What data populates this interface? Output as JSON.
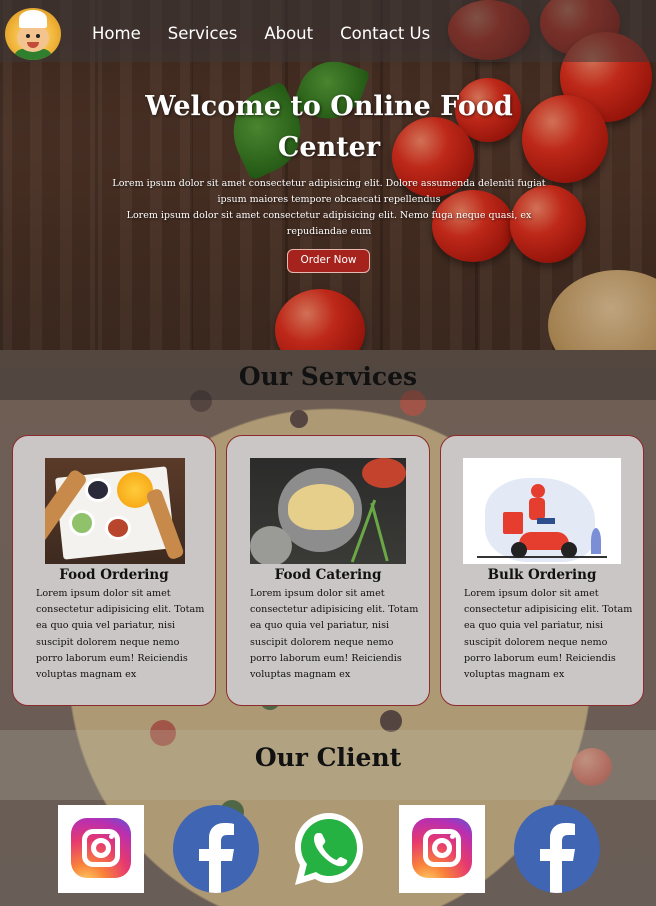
{
  "nav": {
    "links": [
      "Home",
      "Services",
      "About",
      "Contact Us"
    ]
  },
  "hero": {
    "title": "Welcome to Online Food Center",
    "paragraph1": "Lorem ipsum dolor sit amet consectetur adipisicing elit. Dolore assumenda deleniti fugiat ipsum maiores tempore obcaecati repellendus",
    "paragraph2": "Lorem ipsum dolor sit amet consectetur adipisicing elit. Nemo fuga neque quasi, ex repudiandae eum",
    "button": "Order Now",
    "accent_color": "#a6231d"
  },
  "services": {
    "title": "Our Services",
    "cards": [
      {
        "title": "Food Ordering",
        "text": "Lorem ipsum dolor sit amet consectetur adipisicing elit. Totam ea quo quia vel pariatur, nisi suscipit dolorem neque nemo porro laborum eum! Reiciendis voluptas magnam ex",
        "image": "food-platter-image"
      },
      {
        "title": "Food Catering",
        "text": "Lorem ipsum dolor sit amet consectetur adipisicing elit. Totam ea quo quia vel pariatur, nisi suscipit dolorem neque nemo porro laborum eum! Reiciendis voluptas magnam ex",
        "image": "omelette-plate-image"
      },
      {
        "title": "Bulk Ordering",
        "text": "Lorem ipsum dolor sit amet consectetur adipisicing elit. Totam ea quo quia vel pariatur, nisi suscipit dolorem neque nemo porro laborum eum! Reiciendis voluptas magnam ex",
        "image": "delivery-scooter-image"
      }
    ]
  },
  "clients": {
    "title": "Our Client",
    "icons": [
      "instagram-icon",
      "facebook-icon",
      "whatsapp-icon",
      "instagram-icon",
      "facebook-icon"
    ]
  }
}
